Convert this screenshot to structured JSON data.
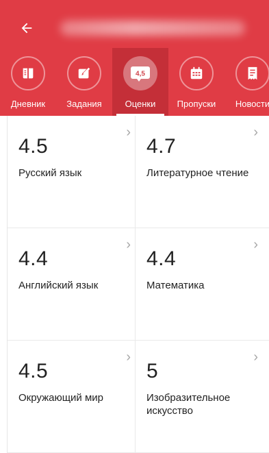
{
  "header": {
    "back_icon": "arrow-left-icon"
  },
  "tabs": [
    {
      "label": "Дневник",
      "icon": "book-icon",
      "active": false
    },
    {
      "label": "Задания",
      "icon": "pencil-square-icon",
      "active": false
    },
    {
      "label": "Оценки",
      "icon": "grade-badge-icon",
      "badge": "4,5",
      "active": true
    },
    {
      "label": "Пропуски",
      "icon": "calendar-icon",
      "active": false
    },
    {
      "label": "Новости",
      "icon": "receipt-icon",
      "active": false
    }
  ],
  "grades": [
    {
      "value": "4.5",
      "subject": "Русский язык"
    },
    {
      "value": "4.7",
      "subject": "Литературное чтение"
    },
    {
      "value": "4.4",
      "subject": "Английский язык"
    },
    {
      "value": "4.4",
      "subject": "Математика"
    },
    {
      "value": "4.5",
      "subject": "Окружающий мир"
    },
    {
      "value": "5",
      "subject": "Изобразительное искусство"
    }
  ],
  "chevron": "›",
  "colors": {
    "accent": "#e03c45",
    "active_tab": "#c42f38"
  }
}
